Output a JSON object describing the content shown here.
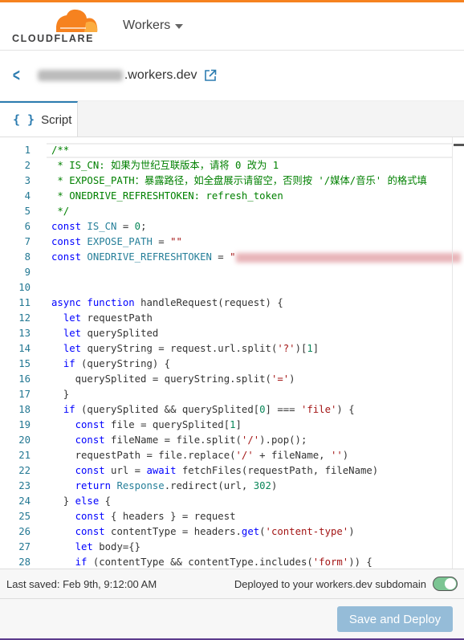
{
  "brand": {
    "name": "CLOUDFLARE",
    "colors": {
      "orange": "#f6821f",
      "light_orange": "#fbad41",
      "accent": "#2c7cb0"
    }
  },
  "nav": {
    "product": "Workers"
  },
  "worker": {
    "domain_suffix": ".workers.dev",
    "back_icon": "chevron-left-icon",
    "external_icon": "external-link-icon"
  },
  "tabs": [
    {
      "label": "Script",
      "icon": "{ }",
      "active": true
    }
  ],
  "editor": {
    "lines": [
      [
        [
          "c",
          "/**"
        ]
      ],
      [
        [
          "c",
          " * IS_CN: 如果为世纪互联版本，请将 0 改为 1"
        ]
      ],
      [
        [
          "c",
          " * EXPOSE_PATH：暴露路径，如全盘展示请留空，否则按 '/媒体/音乐' 的格式填"
        ]
      ],
      [
        [
          "c",
          " * ONEDRIVE_REFRESHTOKEN: refresh_token"
        ]
      ],
      [
        [
          "c",
          " */"
        ]
      ],
      [
        [
          "k",
          "const "
        ],
        [
          "v",
          "IS_CN"
        ],
        [
          "p",
          " = "
        ],
        [
          "n",
          "0"
        ],
        [
          "p",
          ";"
        ]
      ],
      [
        [
          "k",
          "const "
        ],
        [
          "v",
          "EXPOSE_PATH"
        ],
        [
          "p",
          " = "
        ],
        [
          "s",
          "\"\""
        ]
      ],
      [
        [
          "k",
          "const "
        ],
        [
          "v",
          "ONEDRIVE_REFRESHTOKEN"
        ],
        [
          "p",
          " = "
        ],
        [
          "s",
          "\""
        ],
        [
          "blur",
          ""
        ]
      ],
      [],
      [],
      [
        [
          "k",
          "async function "
        ],
        [
          "p",
          "handleRequest(request) {"
        ]
      ],
      [
        [
          "p",
          "  "
        ],
        [
          "k",
          "let "
        ],
        [
          "p",
          "requestPath"
        ]
      ],
      [
        [
          "p",
          "  "
        ],
        [
          "k",
          "let "
        ],
        [
          "p",
          "querySplited"
        ]
      ],
      [
        [
          "p",
          "  "
        ],
        [
          "k",
          "let "
        ],
        [
          "p",
          "queryString = request.url.split("
        ],
        [
          "s",
          "'?'"
        ],
        [
          "p",
          ")["
        ],
        [
          "n",
          "1"
        ],
        [
          "p",
          "]"
        ]
      ],
      [
        [
          "p",
          "  "
        ],
        [
          "k",
          "if "
        ],
        [
          "p",
          "(queryString) {"
        ]
      ],
      [
        [
          "p",
          "    querySplited = queryString.split("
        ],
        [
          "s",
          "'='"
        ],
        [
          "p",
          ")"
        ]
      ],
      [
        [
          "p",
          "  }"
        ]
      ],
      [
        [
          "p",
          "  "
        ],
        [
          "k",
          "if "
        ],
        [
          "p",
          "(querySplited && querySplited["
        ],
        [
          "n",
          "0"
        ],
        [
          "p",
          "] === "
        ],
        [
          "s",
          "'file'"
        ],
        [
          "p",
          ") {"
        ]
      ],
      [
        [
          "p",
          "    "
        ],
        [
          "k",
          "const "
        ],
        [
          "p",
          "file = querySplited["
        ],
        [
          "n",
          "1"
        ],
        [
          "p",
          "]"
        ]
      ],
      [
        [
          "p",
          "    "
        ],
        [
          "k",
          "const "
        ],
        [
          "p",
          "fileName = file.split("
        ],
        [
          "s",
          "'/'"
        ],
        [
          "p",
          ").pop();"
        ]
      ],
      [
        [
          "p",
          "    requestPath = file.replace("
        ],
        [
          "s",
          "'/'"
        ],
        [
          "p",
          " + fileName, "
        ],
        [
          "s",
          "''"
        ],
        [
          "p",
          ")"
        ]
      ],
      [
        [
          "p",
          "    "
        ],
        [
          "k",
          "const "
        ],
        [
          "p",
          "url = "
        ],
        [
          "k",
          "await "
        ],
        [
          "p",
          "fetchFiles(requestPath, fileName)"
        ]
      ],
      [
        [
          "p",
          "    "
        ],
        [
          "k",
          "return "
        ],
        [
          "t",
          "Response"
        ],
        [
          "p",
          ".redirect(url, "
        ],
        [
          "n",
          "302"
        ],
        [
          "p",
          ")"
        ]
      ],
      [
        [
          "p",
          "  } "
        ],
        [
          "k",
          "else "
        ],
        [
          "p",
          "{"
        ]
      ],
      [
        [
          "p",
          "    "
        ],
        [
          "k",
          "const "
        ],
        [
          "p",
          "{ headers } = request"
        ]
      ],
      [
        [
          "p",
          "    "
        ],
        [
          "k",
          "const "
        ],
        [
          "p",
          "contentType = headers."
        ],
        [
          "k",
          "get"
        ],
        [
          "p",
          "("
        ],
        [
          "s",
          "'content-type'"
        ],
        [
          "p",
          ")"
        ]
      ],
      [
        [
          "p",
          "    "
        ],
        [
          "k",
          "let "
        ],
        [
          "p",
          "body={}"
        ]
      ],
      [
        [
          "p",
          "    "
        ],
        [
          "k",
          "if "
        ],
        [
          "p",
          "(contentType && contentType.includes("
        ],
        [
          "s",
          "'form'"
        ],
        [
          "p",
          ")) {"
        ]
      ]
    ]
  },
  "status": {
    "last_saved": "Last saved: Feb 9th, 9:12:00 AM",
    "deployed_label": "Deployed to your workers.dev subdomain",
    "deployed": true,
    "toggle_color": "#7cc593"
  },
  "actions": {
    "save_deploy": "Save and Deploy"
  }
}
